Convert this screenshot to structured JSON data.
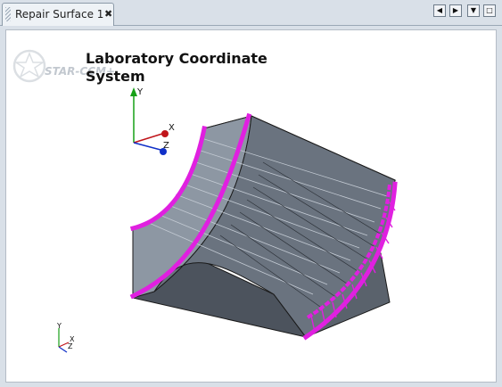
{
  "tab": {
    "label": "Repair Surface 1",
    "close": "✖"
  },
  "tab_controls": {
    "prev": "◀",
    "next": "▶",
    "menu": "▼",
    "maximize": "□"
  },
  "watermark": {
    "text": "STAR-CCM+"
  },
  "scene": {
    "title": "Laboratory Coordinate System"
  },
  "triad": {
    "x": "X",
    "y": "Y",
    "z": "Z"
  },
  "mini_triad": {
    "x": "X",
    "y": "Y",
    "z": "Z"
  },
  "colors": {
    "edge_highlight": "#e020e0",
    "surface_dark": "#4e5560",
    "surface_light": "#8d97a3",
    "axis_x": "#c0141a",
    "axis_y": "#16a016",
    "axis_z": "#1030c8"
  }
}
